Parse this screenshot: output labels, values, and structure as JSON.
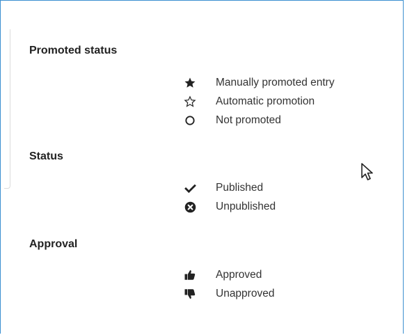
{
  "legend": {
    "promoted": {
      "title": "Promoted status",
      "items": [
        {
          "label": "Manually promoted entry",
          "icon": "star-filled-icon"
        },
        {
          "label": "Automatic promotion",
          "icon": "star-outline-icon"
        },
        {
          "label": "Not promoted",
          "icon": "circle-outline-icon"
        }
      ]
    },
    "status": {
      "title": "Status",
      "items": [
        {
          "label": "Published",
          "icon": "check-icon"
        },
        {
          "label": "Unpublished",
          "icon": "x-circle-icon"
        }
      ]
    },
    "approval": {
      "title": "Approval",
      "items": [
        {
          "label": "Approved",
          "icon": "thumbs-up-icon"
        },
        {
          "label": "Unapproved",
          "icon": "thumbs-down-icon"
        }
      ]
    }
  },
  "colors": {
    "frame_border": "#3b8fd0",
    "text": "#333333"
  }
}
